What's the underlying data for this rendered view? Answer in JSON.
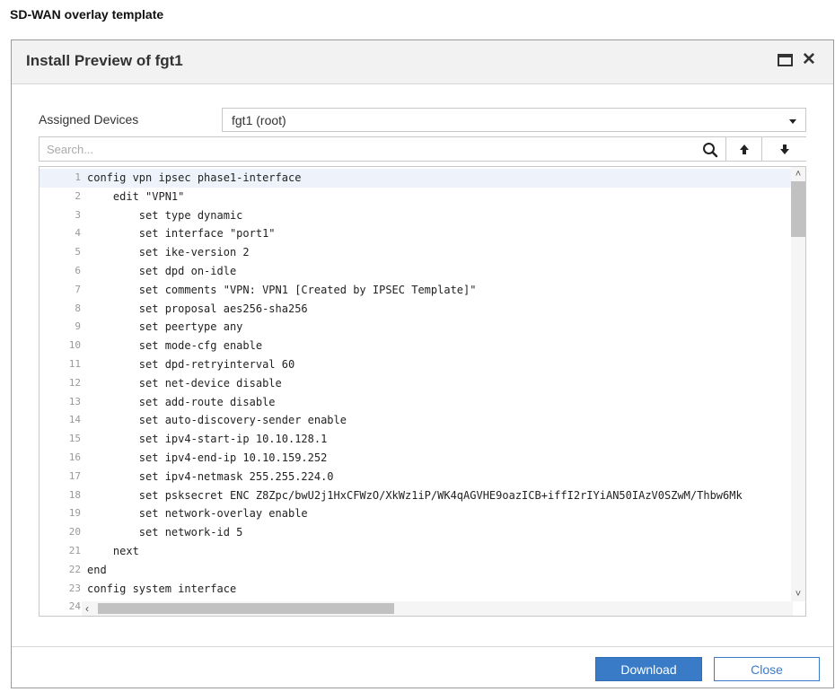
{
  "page": {
    "heading": "SD-WAN overlay template"
  },
  "dialog": {
    "title": "Install Preview of fgt1",
    "assigned_devices_label": "Assigned Devices",
    "assigned_devices_value": "fgt1 (root)",
    "search_placeholder": "Search...",
    "buttons": {
      "download": "Download",
      "close": "Close"
    }
  },
  "code": {
    "lines": [
      {
        "n": "1",
        "text": "config vpn ipsec phase1-interface"
      },
      {
        "n": "2",
        "text": "    edit \"VPN1\""
      },
      {
        "n": "3",
        "text": "        set type dynamic"
      },
      {
        "n": "4",
        "text": "        set interface \"port1\""
      },
      {
        "n": "5",
        "text": "        set ike-version 2"
      },
      {
        "n": "6",
        "text": "        set dpd on-idle"
      },
      {
        "n": "7",
        "text": "        set comments \"VPN: VPN1 [Created by IPSEC Template]\""
      },
      {
        "n": "8",
        "text": "        set proposal aes256-sha256"
      },
      {
        "n": "9",
        "text": "        set peertype any"
      },
      {
        "n": "10",
        "text": "        set mode-cfg enable"
      },
      {
        "n": "11",
        "text": "        set dpd-retryinterval 60"
      },
      {
        "n": "12",
        "text": "        set net-device disable"
      },
      {
        "n": "13",
        "text": "        set add-route disable"
      },
      {
        "n": "14",
        "text": "        set auto-discovery-sender enable"
      },
      {
        "n": "15",
        "text": "        set ipv4-start-ip 10.10.128.1"
      },
      {
        "n": "16",
        "text": "        set ipv4-end-ip 10.10.159.252"
      },
      {
        "n": "17",
        "text": "        set ipv4-netmask 255.255.224.0"
      },
      {
        "n": "18",
        "text": "        set psksecret ENC Z8Zpc/bwU2j1HxCFWzO/XkWz1iP/WK4qAGVHE9oazICB+iffI2rIYiAN50IAzV0SZwM/Thbw6Mk"
      },
      {
        "n": "19",
        "text": "        set network-overlay enable"
      },
      {
        "n": "20",
        "text": "        set network-id 5"
      },
      {
        "n": "21",
        "text": "    next"
      },
      {
        "n": "22",
        "text": "end"
      },
      {
        "n": "23",
        "text": "config system interface"
      },
      {
        "n": "24",
        "text": ""
      }
    ]
  },
  "colors": {
    "accent": "#3a7bc8",
    "header_bg": "#f2f2f2"
  }
}
